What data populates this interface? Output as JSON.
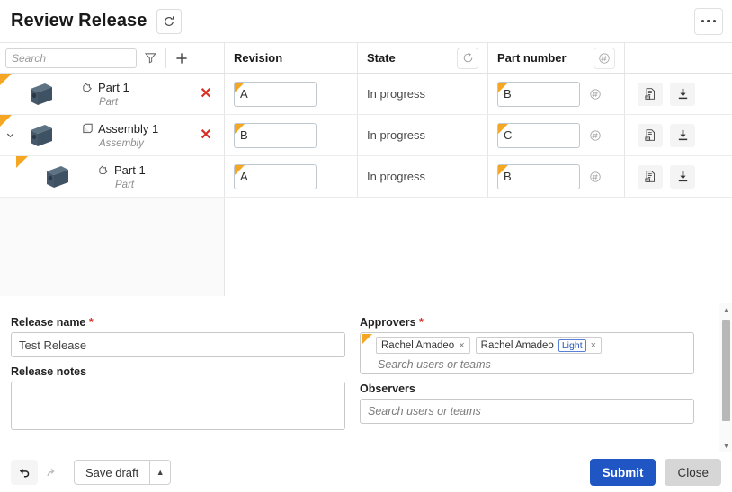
{
  "window": {
    "title": "Review Release",
    "refresh_icon": "refresh-icon",
    "overflow_icon": "kebab-menu-icon"
  },
  "toolbar": {
    "search_placeholder": "Search",
    "search_value": "",
    "filter_icon": "filter-icon",
    "add_icon": "plus-icon"
  },
  "table": {
    "columns": [
      {
        "key": "tree",
        "label": ""
      },
      {
        "key": "revision",
        "label": "Revision"
      },
      {
        "key": "state",
        "label": "State",
        "icon": "update-state-icon"
      },
      {
        "key": "part_number",
        "label": "Part number",
        "icon": "auto-number-icon"
      },
      {
        "key": "actions",
        "label": ""
      }
    ],
    "rows": [
      {
        "name": "Part 1",
        "type": "Part",
        "type_icon": "part-icon",
        "thumbnail_icon": "cad-plate-thumbnail",
        "indent": 0,
        "expandable": false,
        "expanded": false,
        "flagged": true,
        "delete_icon": "delete-x-icon",
        "revision": "A",
        "revision_flagged": true,
        "state": "In progress",
        "part_number": "B",
        "part_number_flagged": true,
        "actions": [
          "bom-report-icon",
          "download-icon"
        ]
      },
      {
        "name": "Assembly 1",
        "type": "Assembly",
        "type_icon": "assembly-icon",
        "thumbnail_icon": "cad-plate-thumbnail",
        "indent": 0,
        "expandable": true,
        "expanded": true,
        "flagged": true,
        "delete_icon": "delete-x-icon",
        "revision": "B",
        "revision_flagged": true,
        "state": "In progress",
        "part_number": "C",
        "part_number_flagged": true,
        "actions": [
          "bom-report-icon",
          "download-icon"
        ]
      },
      {
        "name": "Part 1",
        "type": "Part",
        "type_icon": "part-icon",
        "thumbnail_icon": "cad-plate-thumbnail",
        "indent": 1,
        "expandable": false,
        "expanded": false,
        "flagged": true,
        "delete_icon": "",
        "revision": "A",
        "revision_flagged": true,
        "state": "In progress",
        "part_number": "B",
        "part_number_flagged": true,
        "actions": [
          "bom-report-icon",
          "download-icon"
        ]
      }
    ]
  },
  "form": {
    "release_name_label": "Release name",
    "release_name_required": "*",
    "release_name_value": "Test Release",
    "release_notes_label": "Release notes",
    "release_notes_value": "",
    "approvers_label": "Approvers",
    "approvers_required": "*",
    "approvers_tokens": [
      {
        "name": "Rachel Amadeo",
        "badge": "",
        "remove": "×"
      },
      {
        "name": "Rachel Amadeo",
        "badge": "Light",
        "remove": "×"
      }
    ],
    "approvers_placeholder": "Search users or teams",
    "observers_label": "Observers",
    "observers_placeholder": "Search users or teams",
    "observers_value": ""
  },
  "footer": {
    "undo_icon": "undo-arrow-icon",
    "redo_icon": "redo-arrow-icon",
    "save_draft_label": "Save draft",
    "save_draft_caret": "caret-up-icon",
    "submit_label": "Submit",
    "close_label": "Close"
  },
  "colors": {
    "primary": "#1f56c4",
    "flag": "#f5a623",
    "danger": "#d93025",
    "secondary": "#d6d6d6"
  }
}
